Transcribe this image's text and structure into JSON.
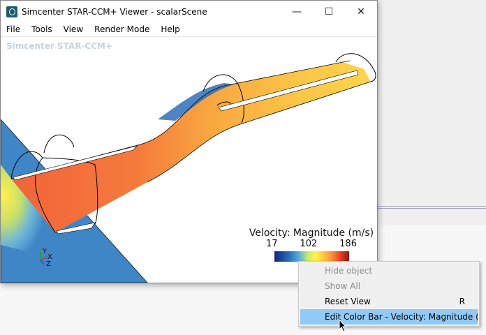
{
  "window": {
    "title": "Simcenter STAR-CCM+ Viewer - scalarScene",
    "minimize": "—",
    "maximize": "☐",
    "close": "✕"
  },
  "menubar": [
    "File",
    "Tools",
    "View",
    "Render Mode",
    "Help"
  ],
  "viewport": {
    "watermark": "Simcenter STAR-CCM+",
    "axes": {
      "x": "X",
      "y": "Y",
      "z": "Z"
    }
  },
  "legend": {
    "title": "Velocity: Magnitude (m/s)",
    "min": "17",
    "mid": "102",
    "max": "186"
  },
  "context_menu": {
    "items": [
      {
        "label": "Hide object",
        "enabled": false,
        "shortcut": ""
      },
      {
        "label": "Show All",
        "enabled": false,
        "shortcut": ""
      },
      {
        "label": "Reset View",
        "enabled": true,
        "shortcut": "R"
      },
      {
        "label": "Edit Color Bar - Velocity: Magnitude  (m/s)",
        "enabled": true,
        "shortcut": "",
        "highlighted": true
      }
    ]
  },
  "colors": {
    "highlight": "#91c9f7",
    "plane": "#3f86c6"
  }
}
